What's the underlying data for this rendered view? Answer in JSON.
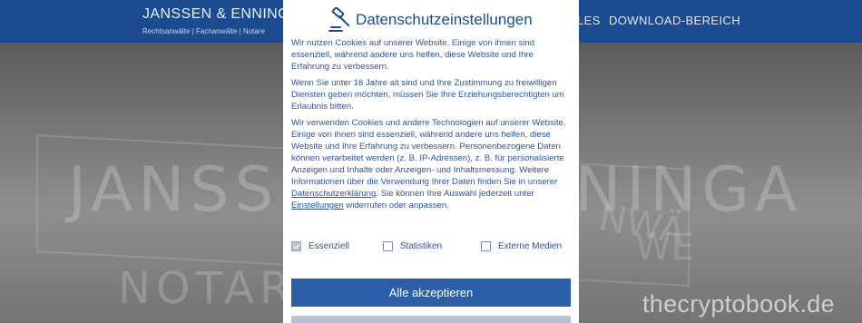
{
  "site": {
    "brand_name": "JANSSEN & ENNINGA",
    "brand_sub": "Rechtsanwälte | Fachanwälte | Notare",
    "nav_partial": "LES",
    "nav_download": "DOWNLOAD-BEREICH",
    "hero_sign_line1": "JANSSEN & ENNINGA",
    "hero_sign_line2": "NOTARE",
    "hero_side_1": "NWÄ",
    "hero_side_2": "WE",
    "watermark": "thecryptobook.de"
  },
  "modal": {
    "title": "Datenschutzeinstellungen",
    "p1": "Wir nutzen Cookies auf unserer Website. Einige von ihnen sind essenziell, während andere uns helfen, diese Website und Ihre Erfahrung zu verbessern.",
    "p2": "Wenn Sie unter 16 Jahre alt sind und Ihre Zustimmung zu freiwilligen Diensten geben möchten, müssen Sie Ihre Erziehungsberechtigten um Erlaubnis bitten.",
    "p3_main": "Wir verwenden Cookies und andere Technologien auf unserer Website. Einige von ihnen sind essenziell, während andere uns helfen, diese Website und Ihre Erfahrung zu verbessern. Personenbezogene Daten können verarbeitet werden (z. B. IP-Adressen), z. B. für personalisierte Anzeigen und Inhalte oder Anzeigen- und Inhaltsmessung. Weitere Informationen über die Verwendung Ihrer Daten finden Sie in unserer ",
    "p3_link_privacy": "Datenschutzerklärung",
    "p3_mid": ". Sie können Ihre Auswahl jederzeit unter ",
    "p3_link_settings": "Einstellungen",
    "p3_end": " widerrufen oder anpassen.",
    "options": [
      {
        "label": "Essenziell",
        "checked": true
      },
      {
        "label": "Statistiken",
        "checked": false
      },
      {
        "label": "Externe Medien",
        "checked": false
      }
    ],
    "accept_all_label": "Alle akzeptieren"
  }
}
